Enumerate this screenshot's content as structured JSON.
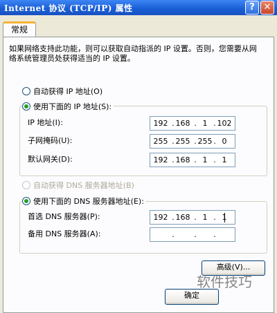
{
  "window": {
    "title": "Internet 协议 (TCP/IP) 属性",
    "help_glyph": "?",
    "close_glyph": "✕"
  },
  "tabs": [
    {
      "label": "常规",
      "selected": true
    }
  ],
  "description": "如果网络支持此功能，则可以获取自动指派的 IP 设置。否则，您需要从网络系统管理员处获得适当的 IP 设置。",
  "ip_mode": {
    "auto_label": "自动获得 IP 地址(O)",
    "manual_label": "使用下面的 IP 地址(S):",
    "selected": "manual"
  },
  "ip_fields": [
    {
      "label": "IP 地址(I):",
      "octets": [
        "192",
        "168",
        "1",
        "102"
      ]
    },
    {
      "label": "子网掩码(U):",
      "octets": [
        "255",
        "255",
        "255",
        "0"
      ]
    },
    {
      "label": "默认网关(D):",
      "octets": [
        "192",
        "168",
        "1",
        "1"
      ]
    }
  ],
  "dns_mode": {
    "auto_label": "自动获得 DNS 服务器地址(B)",
    "manual_label": "使用下面的 DNS 服务器地址(E):",
    "selected": "manual",
    "auto_enabled": false
  },
  "dns_fields": [
    {
      "label": "首选 DNS 服务器(P):",
      "octets": [
        "192",
        "168",
        "1",
        "1"
      ]
    },
    {
      "label": "备用 DNS 服务器(A):",
      "octets": [
        "",
        "",
        "",
        ""
      ]
    }
  ],
  "buttons": {
    "advanced": "高级(V)...",
    "ok": "确定"
  },
  "watermark": "软件技巧"
}
